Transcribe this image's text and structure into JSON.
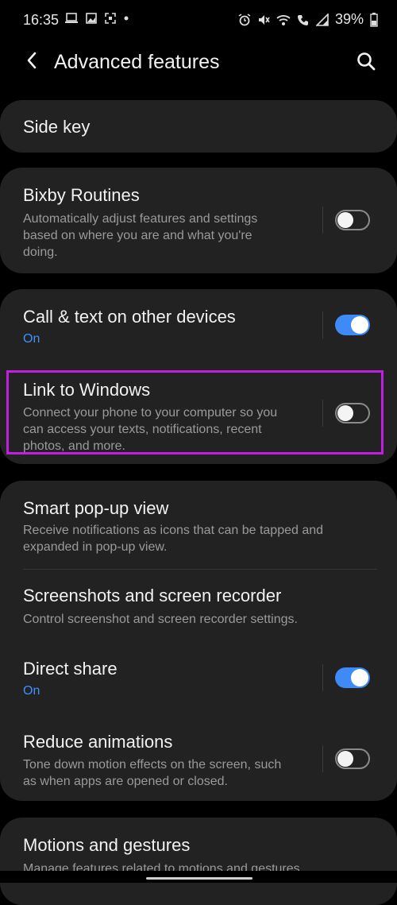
{
  "status_bar": {
    "time": "16:35",
    "left_icons": [
      "laptop-icon",
      "image-icon",
      "screenshot-icon",
      "dot-icon"
    ],
    "right_icons": [
      "alarm-icon",
      "mute-icon",
      "wifi-icon",
      "call-icon",
      "signal-icon",
      "battery-icon"
    ],
    "battery": "39%"
  },
  "app_bar": {
    "title": "Advanced features",
    "back_icon": "back-chevron-icon",
    "search_icon": "search-icon"
  },
  "items": {
    "side_key": {
      "title": "Side key"
    },
    "bixby": {
      "title": "Bixby Routines",
      "sub1": "Automatically adjust features and settings",
      "sub2": "based on where you are and what you're",
      "sub3": "doing.",
      "toggle": false
    },
    "call_text": {
      "title": "Call & text on other devices",
      "status": "On",
      "toggle": true
    },
    "link_windows": {
      "title": "Link to Windows",
      "sub1": "Connect your phone to your computer so you",
      "sub2": "can access your texts, notifications, recent",
      "sub3": "photos, and more.",
      "toggle": false
    },
    "smart_popup": {
      "title": "Smart pop-up view",
      "sub1": "Receive notifications as icons that can be tapped and",
      "sub2": "expanded in pop-up view."
    },
    "screenshots": {
      "title": "Screenshots and screen recorder",
      "sub1": "Control screenshot and screen recorder settings."
    },
    "direct_share": {
      "title": "Direct share",
      "status": "On",
      "toggle": true
    },
    "reduce_anim": {
      "title": "Reduce animations",
      "sub1": "Tone down motion effects on the screen, such",
      "sub2": "as when apps are opened or closed.",
      "toggle": false
    },
    "motions": {
      "title": "Motions and gestures",
      "sub1": "Manage features related to motions and gestures."
    }
  },
  "colors": {
    "background": "#000000",
    "card": "#222222",
    "accent": "#3e8af6",
    "highlight": "#c01fe0"
  }
}
